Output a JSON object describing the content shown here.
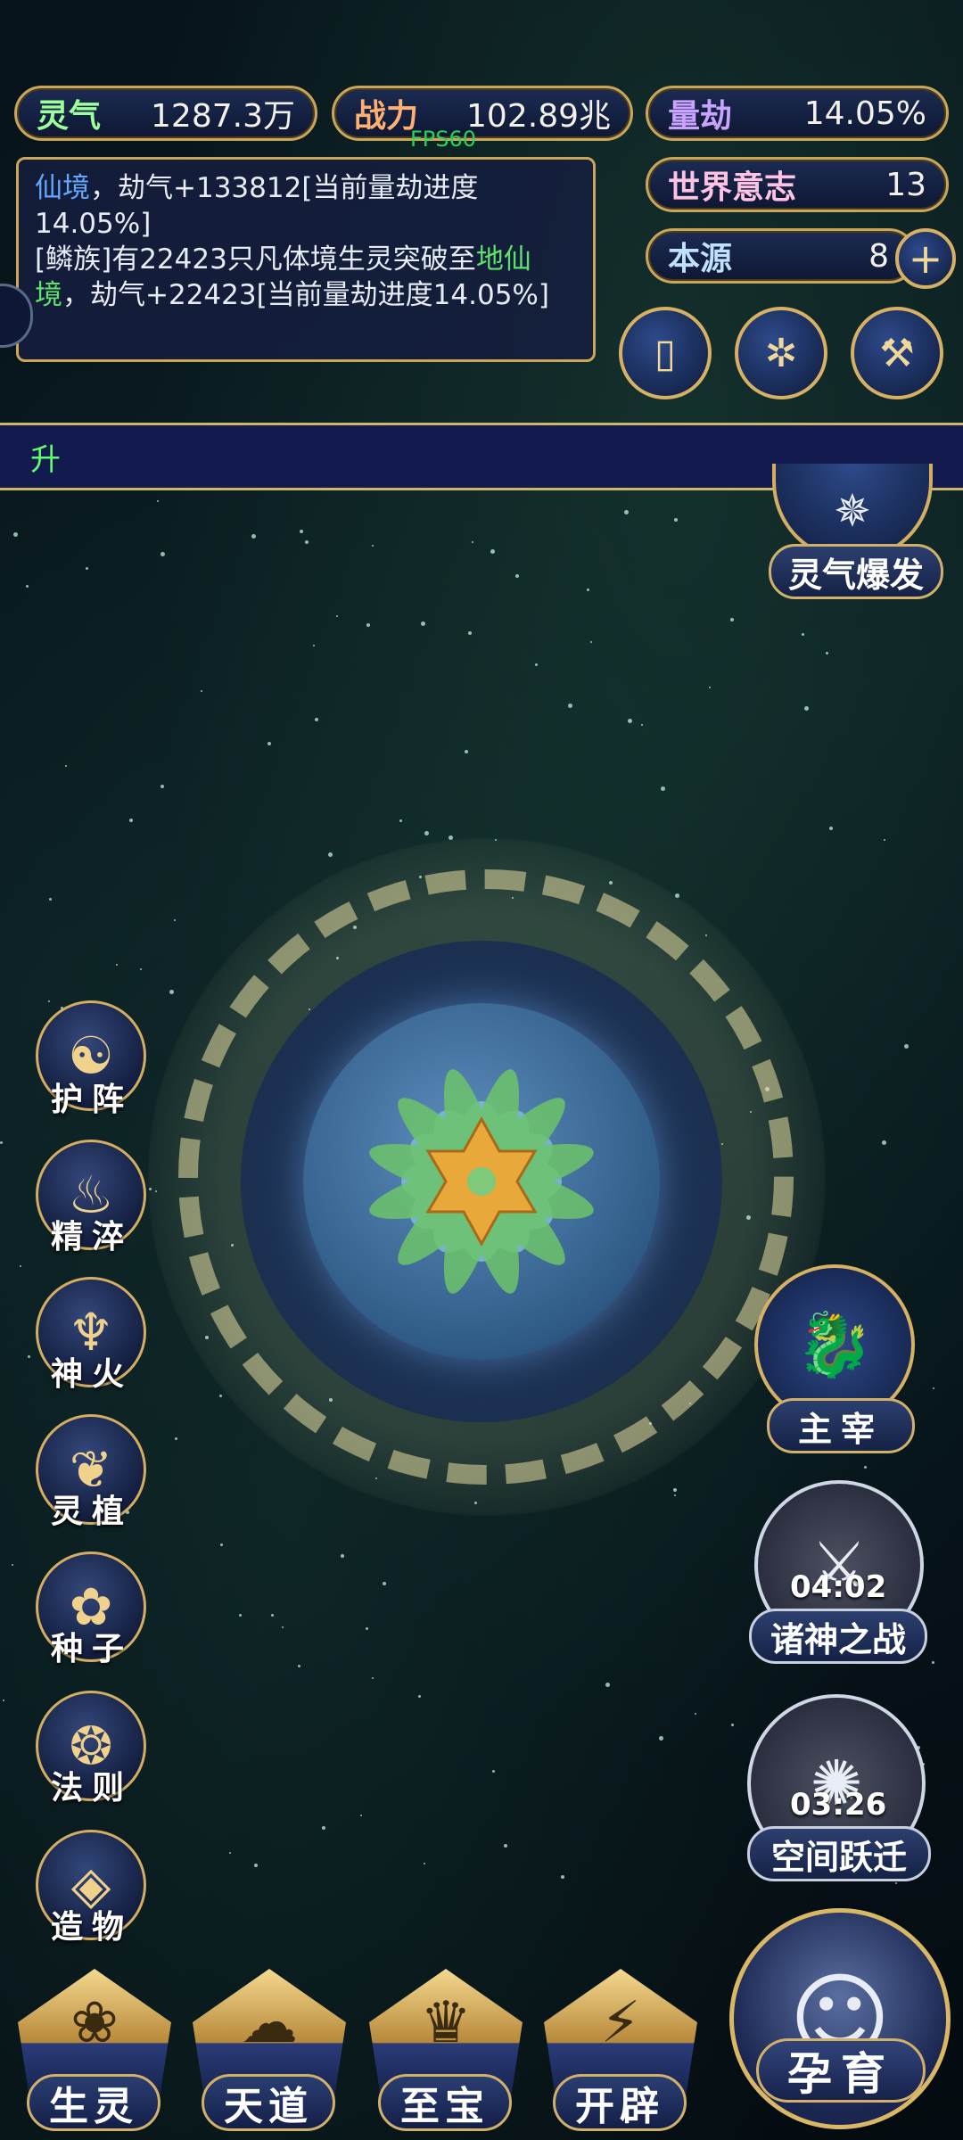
{
  "stats": {
    "lingqi": {
      "label": "灵气",
      "value": "1287.3万"
    },
    "zhanli": {
      "label": "战力",
      "value": "102.89兆"
    },
    "liangjie": {
      "label": "量劫",
      "value": "14.05%"
    },
    "shijie": {
      "label": "世界意志",
      "value": "13"
    },
    "benyuan": {
      "label": "本源",
      "value": "8"
    }
  },
  "fps": "FPS60",
  "log": {
    "line1_hl": "仙境",
    "line1_rest": "，劫气+133812[当前量劫进度14.05%]",
    "line2_pre": "[鳞族]有22423只凡体境生灵突破至",
    "line2_hl": "地仙境",
    "line2_rest": "，劫气+22423[当前量劫进度14.05%]"
  },
  "banner_text": "升",
  "lingqi_baofa": "灵气爆发",
  "left_menu": [
    {
      "label": "护阵",
      "icon": "yin-yang-icon",
      "glyph": "☯"
    },
    {
      "label": "精淬",
      "icon": "flame-lotus-icon",
      "glyph": "♨"
    },
    {
      "label": "神火",
      "icon": "fire-icon",
      "glyph": "♆"
    },
    {
      "label": "灵植",
      "icon": "plant-icon",
      "glyph": "❦"
    },
    {
      "label": "种子",
      "icon": "seed-icon",
      "glyph": "✿"
    },
    {
      "label": "法则",
      "icon": "rule-icon",
      "glyph": "❂"
    },
    {
      "label": "造物",
      "icon": "creation-icon",
      "glyph": "◈"
    }
  ],
  "right_features": {
    "zhuzai": {
      "label": "主宰",
      "glyph": "🐉"
    },
    "zhushen": {
      "label": "诸神之战",
      "timer": "04:02",
      "glyph": "⚔"
    },
    "kongjian": {
      "label": "空间跃迁",
      "timer": "03:26",
      "glyph": "✺"
    }
  },
  "bottom_nav": [
    {
      "label": "生灵",
      "icon": "creature-icon",
      "glyph": "❀"
    },
    {
      "label": "天道",
      "icon": "heaven-icon",
      "glyph": "☁"
    },
    {
      "label": "至宝",
      "icon": "treasure-icon",
      "glyph": "♛"
    },
    {
      "label": "开辟",
      "icon": "open-icon",
      "glyph": "⚡"
    }
  ],
  "yunyu": {
    "label": "孕育",
    "glyph": "☺"
  }
}
